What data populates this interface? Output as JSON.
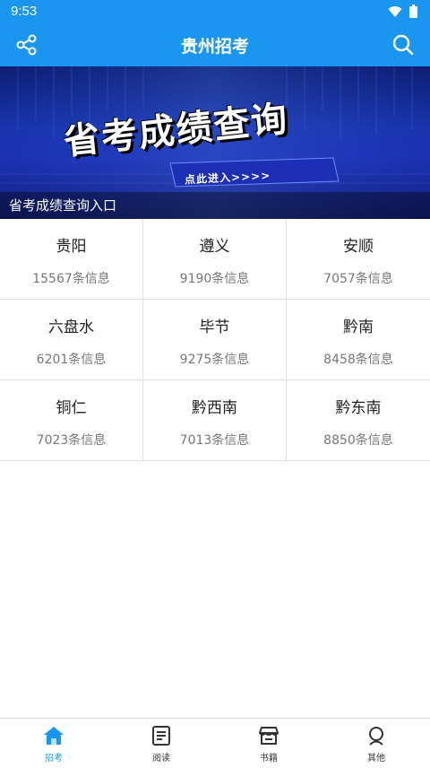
{
  "status": {
    "time": "9:53"
  },
  "appbar": {
    "title": "贵州招考",
    "share_icon": "share-icon",
    "search_icon": "search-icon"
  },
  "banner": {
    "headline": "省考成绩查询",
    "enter_text": "点此进入>>>>",
    "caption": "省考成绩查询入口"
  },
  "regions": [
    {
      "city": "贵阳",
      "count": "15567条信息"
    },
    {
      "city": "遵义",
      "count": "9190条信息"
    },
    {
      "city": "安顺",
      "count": "7057条信息"
    },
    {
      "city": "六盘水",
      "count": "6201条信息"
    },
    {
      "city": "毕节",
      "count": "9275条信息"
    },
    {
      "city": "黔南",
      "count": "8458条信息"
    },
    {
      "city": "铜仁",
      "count": "7023条信息"
    },
    {
      "city": "黔西南",
      "count": "7013条信息"
    },
    {
      "city": "黔东南",
      "count": "8850条信息"
    }
  ],
  "tabs": [
    {
      "label": "招考",
      "icon": "home-icon",
      "active": true
    },
    {
      "label": "阅读",
      "icon": "reading-icon",
      "active": false
    },
    {
      "label": "书籍",
      "icon": "store-icon",
      "active": false
    },
    {
      "label": "其他",
      "icon": "person-icon",
      "active": false
    }
  ],
  "colors": {
    "primary": "#1a96f0"
  }
}
